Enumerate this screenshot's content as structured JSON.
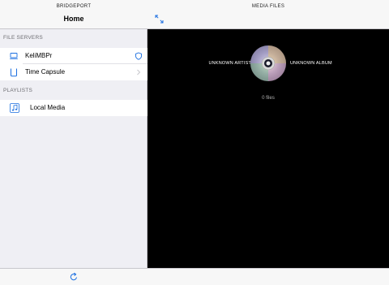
{
  "left_pane": {
    "app_name": "BRIDGEPORT",
    "title": "Home",
    "sections": {
      "file_servers": {
        "header": "FILE SERVERS",
        "items": [
          {
            "label": "KeliMBPr",
            "icon": "laptop-icon",
            "accessory": "shield-icon"
          },
          {
            "label": "Time Capsule",
            "icon": "time-capsule-icon",
            "accessory": "chevron-right-icon"
          }
        ]
      },
      "playlists": {
        "header": "PLAYLISTS",
        "items": [
          {
            "label": "Local Media",
            "icon": "music-note-icon"
          }
        ]
      }
    },
    "footer": {
      "refresh_icon": "refresh-icon"
    }
  },
  "right_pane": {
    "title": "MEDIA FILES",
    "expand_icon": "expand-arrows-icon",
    "now_playing": {
      "artist": "UNKNOWN ARTIST",
      "album": "UNKNOWN ALBUM",
      "artwork": "cd-disc-icon",
      "file_count": "0 files"
    }
  },
  "colors": {
    "accent": "#1a6ee0",
    "chrome_bg": "#f7f7f7",
    "grouped_bg": "#efeff4",
    "content_bg": "#000000"
  }
}
